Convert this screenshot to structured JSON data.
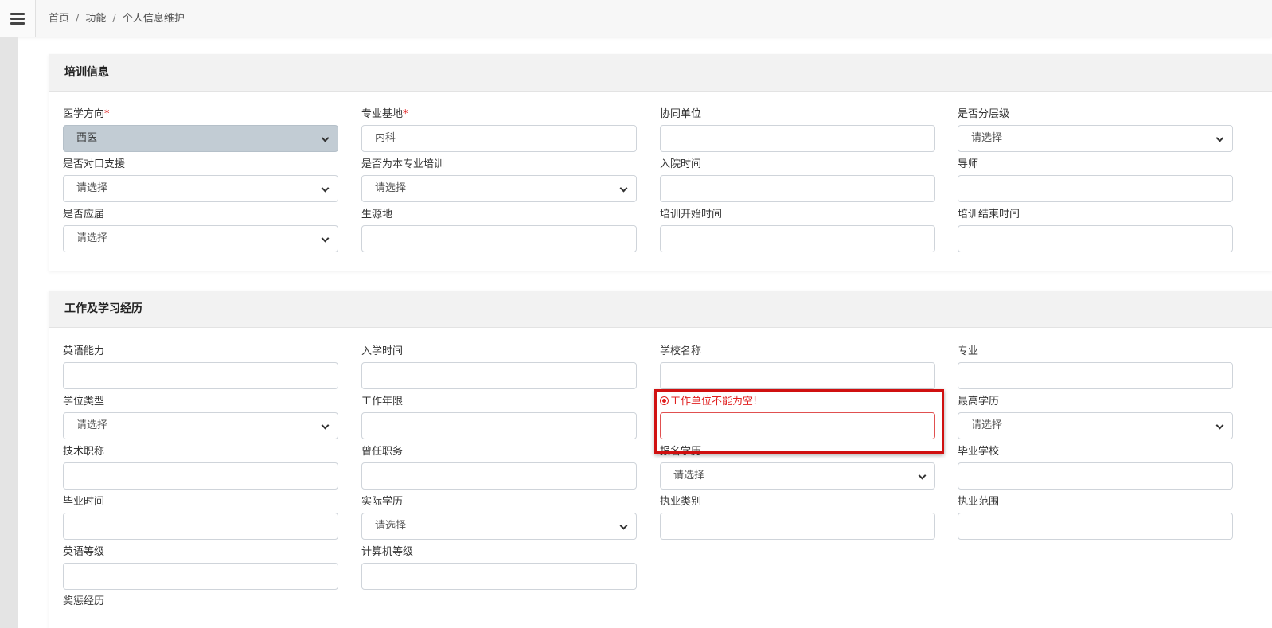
{
  "breadcrumb": {
    "home": "首页",
    "section": "功能",
    "current": "个人信息维护",
    "separator": "/"
  },
  "training": {
    "title": "培训信息",
    "fields": {
      "medical_direction": {
        "label": "医学方向",
        "required": "*",
        "value": "西医"
      },
      "specialty_base": {
        "label": "专业基地",
        "required": "*",
        "value": "内科"
      },
      "partner_unit": {
        "label": "协同单位",
        "value": ""
      },
      "is_tiered": {
        "label": "是否分层级",
        "value": "请选择"
      },
      "paired_support": {
        "label": "是否对口支援",
        "value": "请选择"
      },
      "own_specialty": {
        "label": "是否为本专业培训",
        "value": "请选择"
      },
      "admission_time": {
        "label": "入院时间",
        "value": ""
      },
      "mentor": {
        "label": "导师",
        "value": ""
      },
      "is_fresh_grad": {
        "label": "是否应届",
        "value": "请选择"
      },
      "origin": {
        "label": "生源地",
        "value": ""
      },
      "train_start": {
        "label": "培训开始时间",
        "value": ""
      },
      "train_end": {
        "label": "培训结束时间",
        "value": ""
      }
    }
  },
  "experience": {
    "title": "工作及学习经历",
    "fields": {
      "english_ability": {
        "label": "英语能力",
        "value": ""
      },
      "enroll_time": {
        "label": "入学时间",
        "value": ""
      },
      "school_name": {
        "label": "学校名称",
        "value": ""
      },
      "major": {
        "label": "专业",
        "value": ""
      },
      "degree_type": {
        "label": "学位类型",
        "value": "请选择"
      },
      "work_years": {
        "label": "工作年限",
        "value": ""
      },
      "work_unit_error": {
        "label": "工作单位不能为空!",
        "value": ""
      },
      "highest_edu": {
        "label": "最高学历",
        "value": "请选择"
      },
      "tech_title": {
        "label": "技术职称",
        "value": ""
      },
      "former_post": {
        "label": "曾任职务",
        "value": ""
      },
      "signup_edu": {
        "label": "报名学历",
        "value": "请选择"
      },
      "grad_school": {
        "label": "毕业学校",
        "value": ""
      },
      "grad_time": {
        "label": "毕业时间",
        "value": ""
      },
      "actual_edu": {
        "label": "实际学历",
        "value": "请选择"
      },
      "practice_category": {
        "label": "执业类别",
        "value": ""
      },
      "practice_scope": {
        "label": "执业范围",
        "value": ""
      },
      "english_level": {
        "label": "英语等级",
        "value": ""
      },
      "computer_level": {
        "label": "计算机等级",
        "value": ""
      },
      "rewards": {
        "label": "奖惩经历"
      }
    }
  },
  "colors": {
    "error": "#e02020",
    "highlight": "#d01010",
    "disabled_bg": "#c2ccd4"
  }
}
